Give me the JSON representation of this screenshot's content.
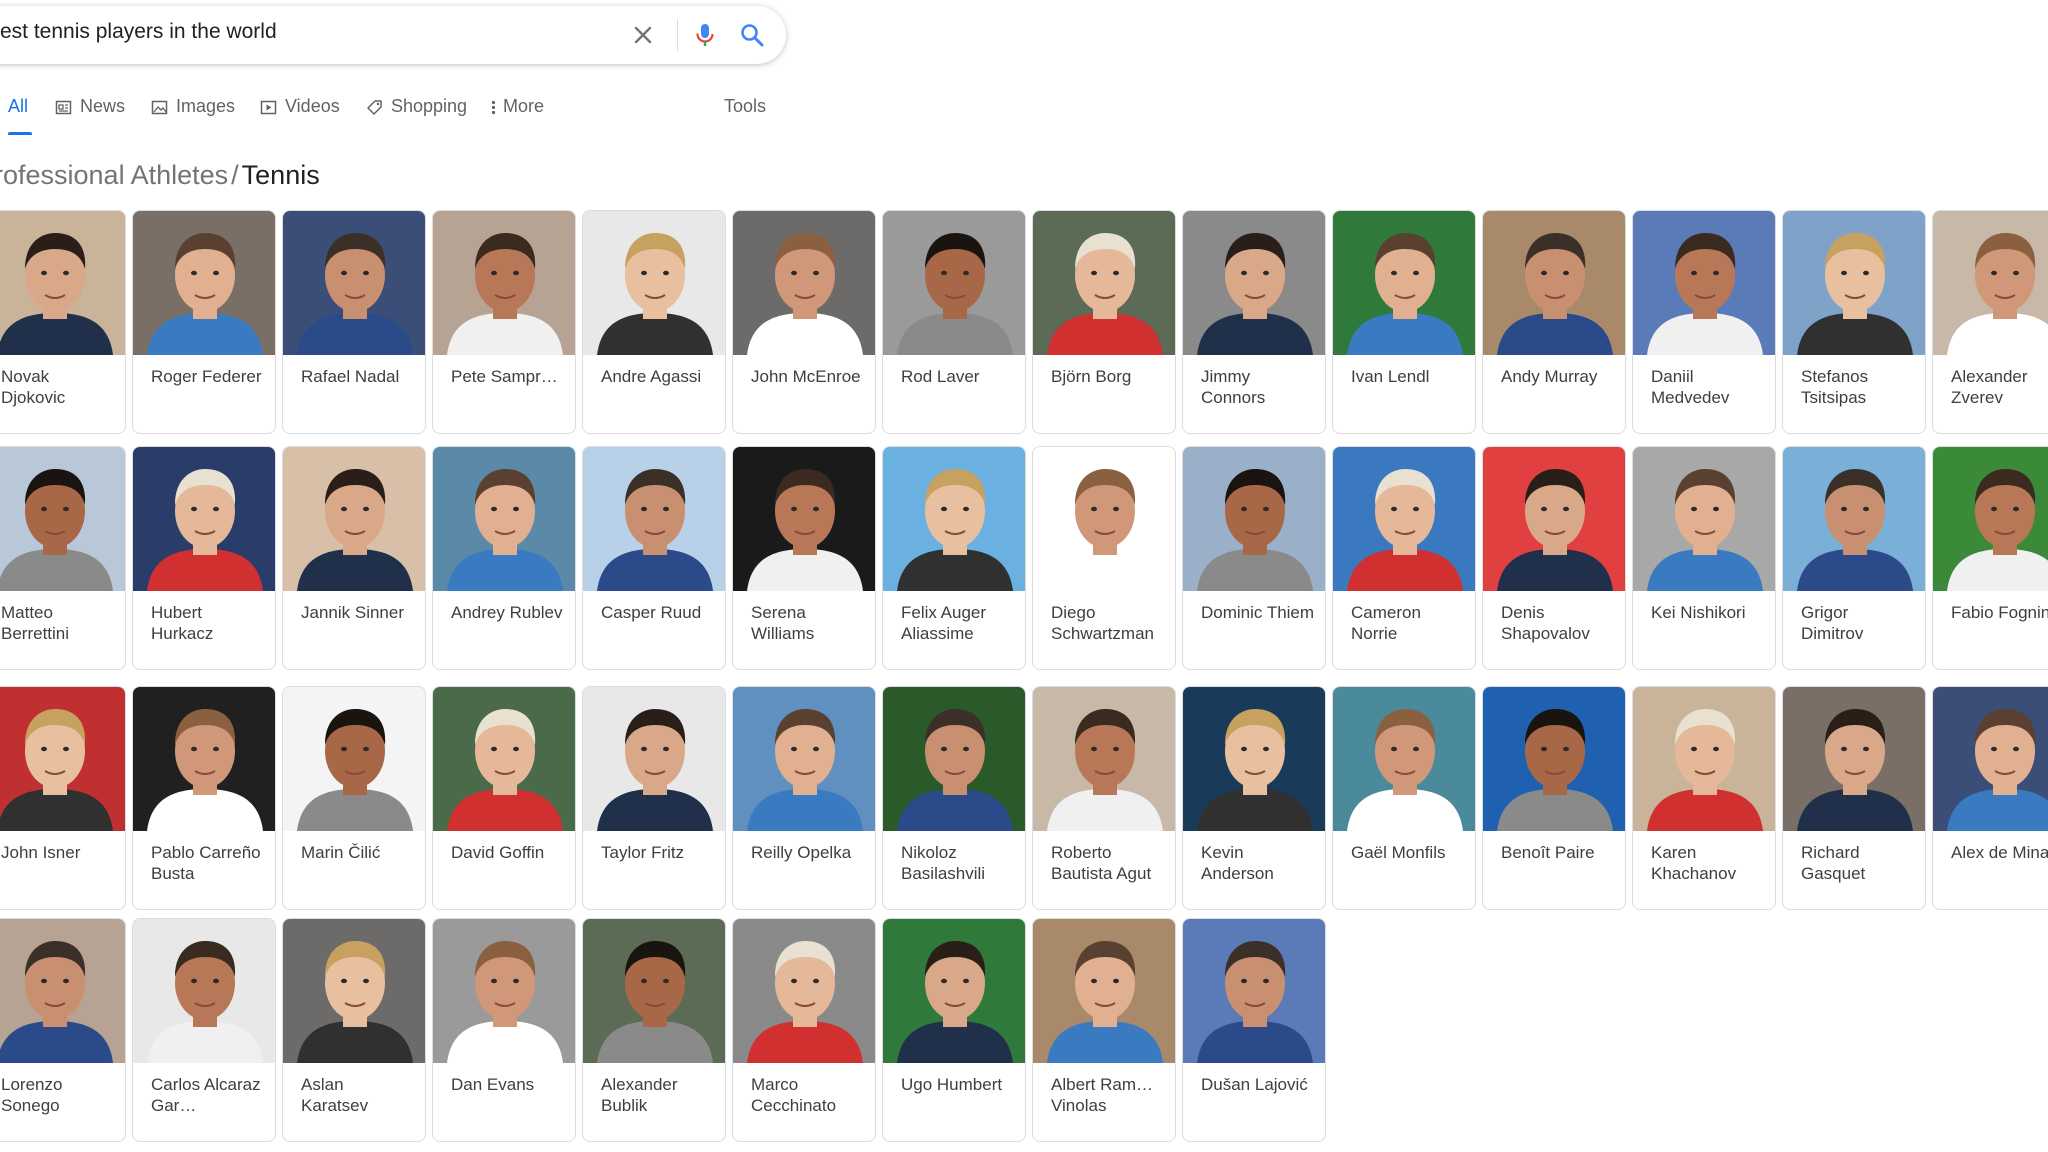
{
  "search": {
    "query": "est tennis players in the world",
    "clear_icon": "close-icon",
    "mic_icon": "microphone-icon",
    "search_icon": "search-icon"
  },
  "tabs": [
    {
      "label": "All",
      "icon": "",
      "active": true
    },
    {
      "label": "News",
      "icon": "news-icon",
      "active": false
    },
    {
      "label": "Images",
      "icon": "image-icon",
      "active": false
    },
    {
      "label": "Videos",
      "icon": "video-icon",
      "active": false
    },
    {
      "label": "Shopping",
      "icon": "tag-icon",
      "active": false
    },
    {
      "label": "More",
      "icon": "more-vert-icon",
      "active": false
    },
    {
      "label": "Tools",
      "icon": "",
      "active": false
    }
  ],
  "breadcrumb": {
    "parent": "rofessional Athletes",
    "separator": "/",
    "current": "Tennis"
  },
  "colors": {
    "accent": "#1a73e8",
    "text": "#202124",
    "secondary_text": "#5f6368",
    "card_border": "#dadce0"
  },
  "players": [
    [
      "Novak Djokovic",
      "Roger Federer",
      "Rafael Nadal",
      "Pete Sampr…",
      "Andre Agassi",
      "John McEnroe",
      "Rod Laver",
      "Björn Borg",
      "Jimmy Connors",
      "Ivan Lendl",
      "Andy Murray",
      "Daniil Medvedev",
      "Stefanos Tsitsipas",
      "Alexander Zverev"
    ],
    [
      "Matteo Berrettini",
      "Hubert Hurkacz",
      "Jannik Sinner",
      "Andrey Rublev",
      "Casper Ruud",
      "Serena Williams",
      "Felix Auger Aliassime",
      "Diego Schwartzman",
      "Dominic Thiem",
      "Cameron Norrie",
      "Denis Shapovalov",
      "Kei Nishikori",
      "Grigor Dimitrov",
      "Fabio Fognini"
    ],
    [
      "John Isner",
      "Pablo Carreño Busta",
      "Marin Čilić",
      "David Goffin",
      "Taylor Fritz",
      "Reilly Opelka",
      "Nikoloz Basilashvili",
      "Roberto Bautista Agut",
      "Kevin Anderson",
      "Gaël Monfils",
      "Benoît Paire",
      "Karen Khachanov",
      "Richard Gasquet",
      "Alex de Minaur"
    ],
    [
      "Lorenzo Sonego",
      "Carlos Alcaraz Gar…",
      "Aslan Karatsev",
      "Dan Evans",
      "Alexander Bublik",
      "Marco Cecchinato",
      "Ugo Humbert",
      "Albert Ram… Vinolas",
      "Dušan Lajović"
    ]
  ]
}
